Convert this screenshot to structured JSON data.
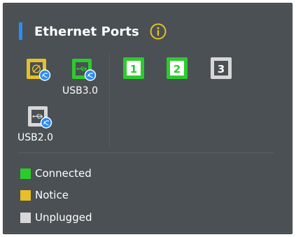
{
  "panel": {
    "title": "Ethernet Ports",
    "info_icon": "info-icon",
    "colors": {
      "accent": "#2b8df0",
      "connected": "#2ccb2c",
      "notice": "#e6bf2a",
      "unplugged": "#d7d7d7",
      "background": "#4a5054"
    }
  },
  "ports": [
    {
      "id": "wan",
      "icon": "ethernet-globe-icon",
      "status": "notice",
      "label": ""
    },
    {
      "id": "usb3",
      "icon": "usb-globe-icon",
      "status": "connected",
      "label": "USB3.0"
    },
    {
      "id": "lan1",
      "icon": "lan-port-icon",
      "status": "connected",
      "label": "1"
    },
    {
      "id": "lan2",
      "icon": "lan-port-icon",
      "status": "connected",
      "label": "2"
    },
    {
      "id": "lan3",
      "icon": "lan-port-icon",
      "status": "unplugged",
      "label": "3"
    },
    {
      "id": "usb2",
      "icon": "usb-globe-icon",
      "status": "unplugged",
      "label": "USB2.0"
    }
  ],
  "legend": [
    {
      "label": "Connected",
      "status": "connected"
    },
    {
      "label": "Notice",
      "status": "notice"
    },
    {
      "label": "Unplugged",
      "status": "unplugged"
    }
  ]
}
